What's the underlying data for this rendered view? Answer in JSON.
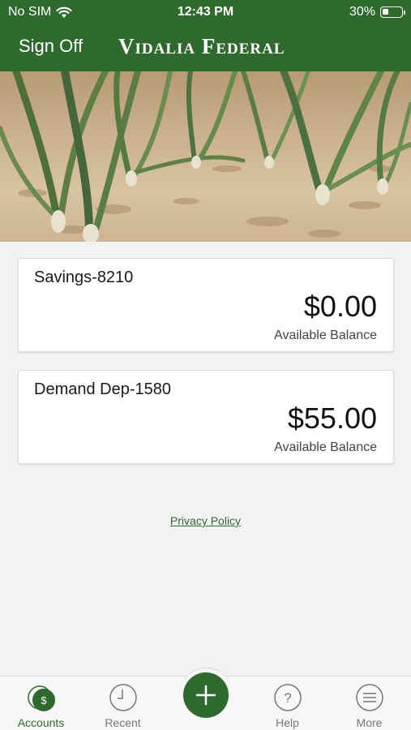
{
  "status_bar": {
    "carrier": "No SIM",
    "time": "12:43 PM",
    "battery": "30%",
    "battery_level": 0.3
  },
  "header": {
    "sign_off_label": "Sign Off",
    "brand": "Vidalia Federal"
  },
  "accounts": [
    {
      "name": "Savings-8210",
      "amount": "$0.00",
      "label": "Available Balance"
    },
    {
      "name": "Demand Dep-1580",
      "amount": "$55.00",
      "label": "Available Balance"
    }
  ],
  "privacy_link": "Privacy Policy",
  "tabbar": {
    "items": [
      {
        "label": "Accounts",
        "icon": "dollar-circle-icon",
        "active": true
      },
      {
        "label": "Recent",
        "icon": "clock-icon",
        "active": false
      },
      {
        "label": "",
        "icon": "plus-icon",
        "active": false
      },
      {
        "label": "Help",
        "icon": "question-circle-icon",
        "active": false
      },
      {
        "label": "More",
        "icon": "menu-circle-icon",
        "active": false
      }
    ]
  },
  "colors": {
    "brand_green": "#2e6a2e",
    "background": "#f2f2f2",
    "tab_inactive": "#777777"
  }
}
